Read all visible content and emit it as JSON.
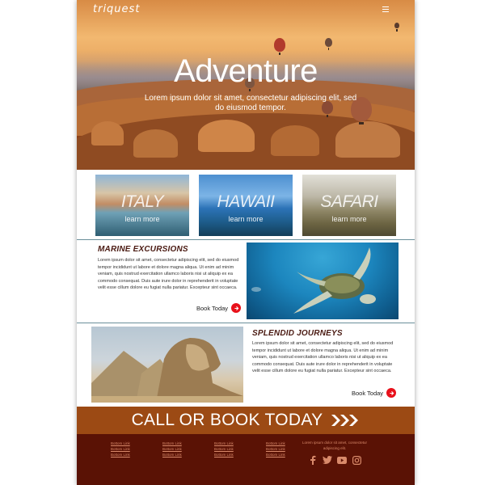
{
  "brand": {
    "logo": "triquest"
  },
  "hero": {
    "title": "Adventure",
    "subtitle": "Lorem ipsum dolor sit amet, consectetur adipiscing elit, sed do eiusmod tempor."
  },
  "destinations": [
    {
      "label": "ITALY",
      "link": "learn more"
    },
    {
      "label": "HAWAII",
      "link": "learn more"
    },
    {
      "label": "SAFARI",
      "link": "learn more"
    }
  ],
  "features": [
    {
      "title": "MARINE EXCURSIONS",
      "body": "Lorem ipsum dolor sit amet, consectetur adipiscing elit, sed do eiusmod tempor incididunt ut labore et dolore magna aliqua. Ut enim ad minim veniam, quis nostrud exercitation ullamco laboris nisi ut aliquip ex ea commodo consequat. Duis aute irure dolor in reprehenderit in voluptate velit esse cillum dolore eu fugiat nulla pariatur. Excepteur sint occaeca.",
      "cta": "Book Today"
    },
    {
      "title": "SPLENDID JOURNEYS",
      "body": "Lorem ipsum dolor sit amet, consectetur adipiscing elit, sed do eiusmod tempor incididunt ut labore et dolore magna aliqua. Ut enim ad minim veniam, quis nostrud exercitation ullamco laboris nisi ut aliquip ex ea commodo consequat. Duis aute irure dolor in reprehenderit in voluptate velit esse cillum dolore eu fugiat nulla pariatur. Excepteur sint occaeca.",
      "cta": "Book Today"
    }
  ],
  "cta_banner": {
    "text": "CALL OR BOOK TODAY"
  },
  "footer": {
    "columns": [
      [
        "Bottom Link",
        "Bottom Link",
        "Bottom Link"
      ],
      [
        "Bottom Link",
        "Bottom Link",
        "Bottom Link"
      ],
      [
        "Bottom Link",
        "Bottom Link",
        "Bottom Link"
      ],
      [
        "Bottom Link",
        "Bottom Link",
        "Bottom Link"
      ]
    ],
    "text": "Lorem ipsum dolor sit amet, consectetur adipiscing elit.",
    "social_icons": [
      "facebook-icon",
      "twitter-icon",
      "youtube-icon",
      "instagram-icon"
    ]
  },
  "colors": {
    "accent_red": "#e8101a",
    "heading_brown": "#4a1a12",
    "cta_orange": "#9c4a14",
    "footer_bg": "#5a1205",
    "footer_link": "#d98a6b"
  }
}
